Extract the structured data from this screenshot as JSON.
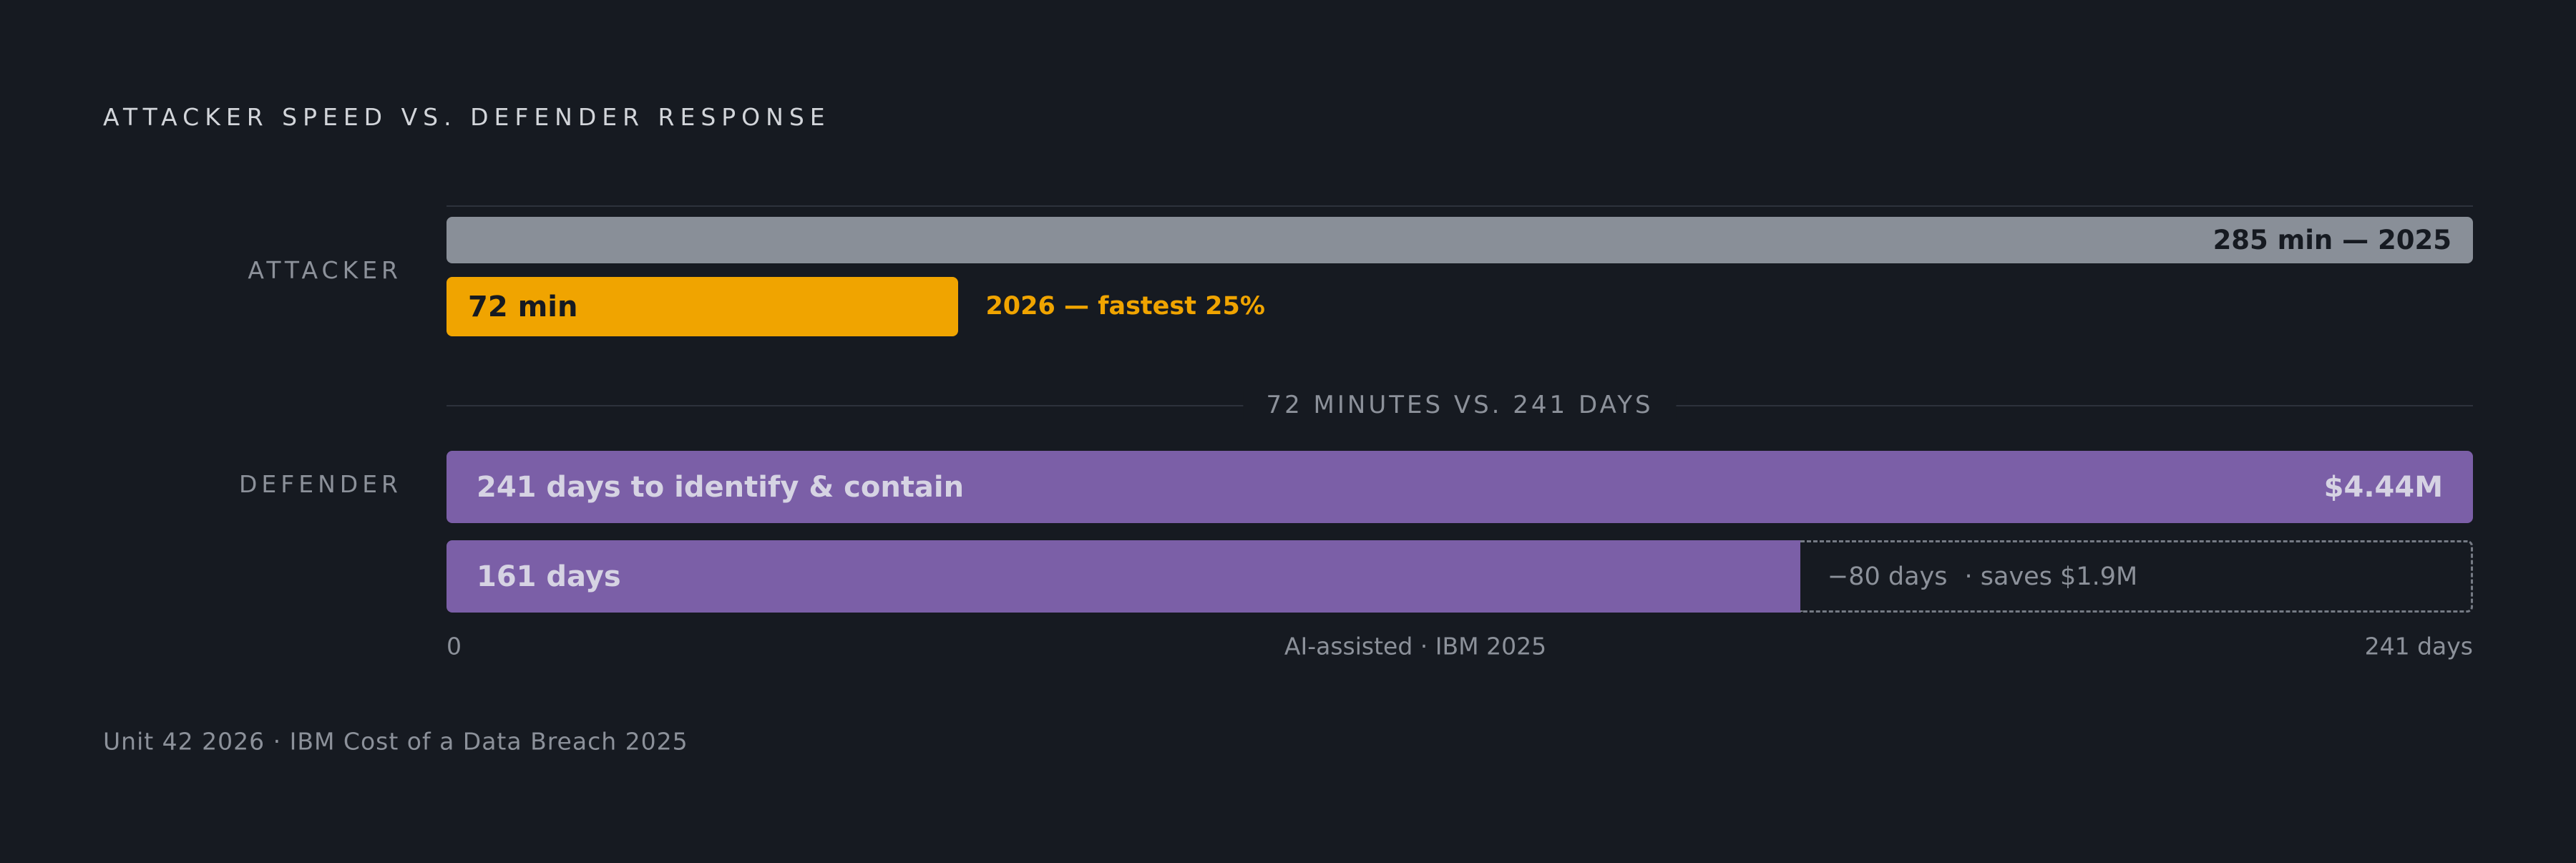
{
  "title": "ATTACKER SPEED VS. DEFENDER RESPONSE",
  "source": "Unit 42 2026 · IBM Cost of a Data Breach 2025",
  "colors": {
    "background": "#161a21",
    "attacker_2025": "#898f98",
    "attacker_2026": "#f0a400",
    "defender": "#7b5fa7"
  },
  "chart_data": {
    "type": "bar",
    "orientation": "horizontal",
    "title": "ATTACKER SPEED VS. DEFENDER RESPONSE",
    "groups": [
      {
        "label": "ATTACKER",
        "scale_max_min": 285,
        "bars": [
          {
            "value": 285,
            "unit": "min",
            "label": "285 min — 2025"
          },
          {
            "value": 72,
            "unit": "min",
            "label": "72 min",
            "note": "2026 — fastest 25%"
          }
        ]
      },
      {
        "label": "DEFENDER",
        "scale_max_days": 241,
        "bars": [
          {
            "value": 241,
            "unit": "days",
            "label": "241 days to identify & contain",
            "value_label": "$4.44M"
          },
          {
            "value": 161,
            "unit": "days",
            "label": "161 days",
            "remainder": 80,
            "remainder_label": "−80 days",
            "savings_label": "· saves $1.9M"
          }
        ]
      }
    ],
    "divider_label": "72 MINUTES VS. 241 DAYS",
    "axis": {
      "min_label": "0",
      "center_label": "AI-assisted · IBM 2025",
      "max_label": "241 days",
      "range": [
        0,
        241
      ]
    }
  }
}
